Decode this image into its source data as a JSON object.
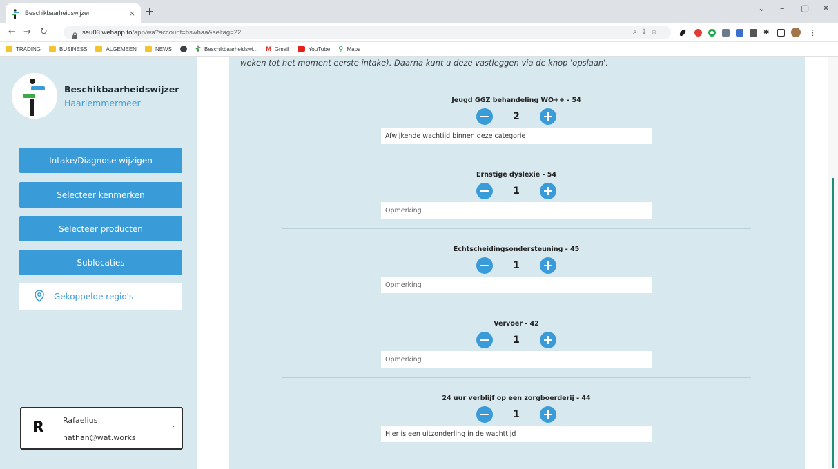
{
  "browser": {
    "tab_title": "Beschikbaarheidswijzer",
    "tab_close": "×",
    "new_tab": "+",
    "url_host": "seu03.webapp.to",
    "url_path": "/app/wa?account=bswhaa&seltag=22",
    "bookmarks": [
      {
        "label": "TRADING",
        "icon": "folder-icon"
      },
      {
        "label": "BUSINESS",
        "icon": "folder-icon"
      },
      {
        "label": "ALGEMEEN",
        "icon": "folder-icon"
      },
      {
        "label": "NEWS",
        "icon": "folder-icon"
      },
      {
        "label": "",
        "icon": "globe-icon"
      },
      {
        "label": "Beschikbaarheidswi...",
        "icon": "site-icon"
      },
      {
        "label": "Gmail",
        "icon": "gmail-icon"
      },
      {
        "label": "YouTube",
        "icon": "youtube-icon"
      },
      {
        "label": "Maps",
        "icon": "maps-icon"
      }
    ],
    "accent": "#3a9bd9"
  },
  "sidebar": {
    "brand_name": "Beschikbaarheidswijzer",
    "brand_sub": "Haarlemmermeer",
    "buttons": [
      {
        "label": "Intake/Diagnose wijzigen"
      },
      {
        "label": "Selecteer kenmerken"
      },
      {
        "label": "Selecteer producten"
      },
      {
        "label": "Sublocaties"
      }
    ],
    "regio_label": "Gekoppelde regio's",
    "user": {
      "initial": "R",
      "name": "Rafaelius",
      "email": "nathan@wat.works"
    }
  },
  "main": {
    "intro": "weken tot het moment eerste intake). Daarna kunt u deze vastleggen via de knop 'opslaan'.",
    "items": [
      {
        "title": "Jeugd GGZ behandeling WO++ - 54",
        "qty": "2",
        "note_value": "Afwijkende wachtijd binnen deze categorie",
        "note_placeholder": "Opmerking"
      },
      {
        "title": "Ernstige dyslexie - 54",
        "qty": "1",
        "note_value": "",
        "note_placeholder": "Opmerking"
      },
      {
        "title": "Echtscheidingsondersteuning - 45",
        "qty": "1",
        "note_value": "",
        "note_placeholder": "Opmerking"
      },
      {
        "title": "Vervoer - 42",
        "qty": "1",
        "note_value": "",
        "note_placeholder": "Opmerking"
      },
      {
        "title": "24 uur verblijf op een zorgboerderij - 44",
        "qty": "1",
        "note_value": "Hier is een uitzonderling in de wachttijd",
        "note_placeholder": "Opmerking"
      }
    ]
  }
}
